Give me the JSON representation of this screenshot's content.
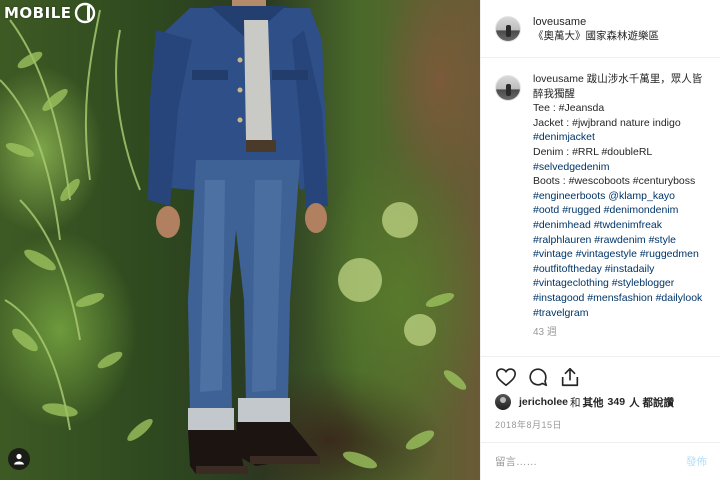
{
  "watermark": {
    "brand": "MOBILE",
    "logo": "01"
  },
  "post": {
    "username": "loveusame",
    "location": "《奧萬大》國家森林遊樂區",
    "caption": {
      "username": "loveusame",
      "lines": [
        "跋山涉水千萬里，眾人皆",
        "醉我獨醒",
        "Tee : #Jeansda",
        "Jacket : #jwjbrand nature indigo",
        "#denimjacket",
        "Denim : #RRL #doubleRL",
        "#selvedgedenim",
        "Boots : #wescoboots #centuryboss",
        "#engineerboots @klamp_kayo",
        "#ootd #rugged #denimondenim",
        "#denimhead #twdenimfreak",
        "#ralphlauren #rawdenim #style",
        "#vintage #vintagestyle #ruggedmen",
        "#outfitoftheday #instadaily",
        "#vintageclothing #styleblogger",
        "#instagood #mensfashion #dailylook",
        "#travelgram"
      ],
      "age": "43 週"
    },
    "likes": {
      "user": "jericholee",
      "connector": "和",
      "others_prefix": "其他",
      "count": "349",
      "suffix": "人 都說讚"
    },
    "date": "2018年8月15日",
    "comment_placeholder": "留言……",
    "post_button": "發佈"
  },
  "icons": {
    "like": "heart-icon",
    "comment": "comment-icon",
    "share": "share-icon",
    "tag": "person-tag-icon"
  },
  "colors": {
    "hashtag": "#003569",
    "muted": "#999999",
    "text": "#262626",
    "divider": "#efefef",
    "post_button_disabled": "#b2dffc"
  }
}
